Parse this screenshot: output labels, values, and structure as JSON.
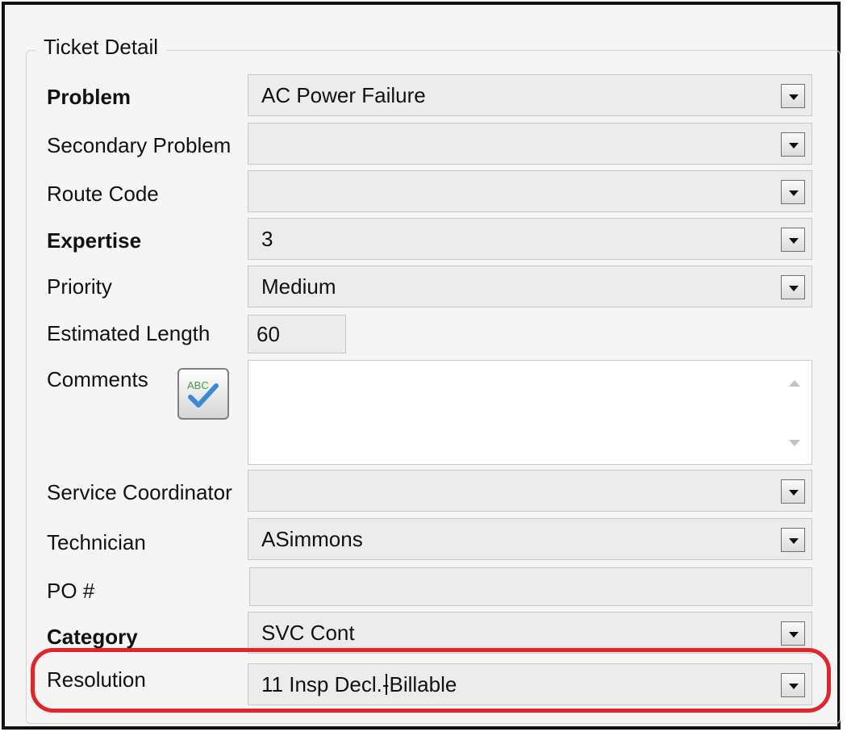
{
  "group_title": "Ticket Detail",
  "fields": {
    "problem": {
      "label": "Problem",
      "value": "AC Power Failure"
    },
    "secondary_problem": {
      "label": "Secondary Problem",
      "value": ""
    },
    "route_code": {
      "label": "Route Code",
      "value": ""
    },
    "expertise": {
      "label": "Expertise",
      "value": "3"
    },
    "priority": {
      "label": "Priority",
      "value": "Medium"
    },
    "estimated_length": {
      "label": "Estimated Length",
      "value": "60"
    },
    "comments": {
      "label": "Comments",
      "value": ""
    },
    "service_coordinator": {
      "label": "Service Coordinator",
      "value": ""
    },
    "technician": {
      "label": "Technician",
      "value": "ASimmons"
    },
    "po_number": {
      "label": "PO #",
      "value": ""
    },
    "category": {
      "label": "Category",
      "value": "SVC Cont"
    },
    "resolution": {
      "label": "Resolution",
      "value_before_caret": "11 Insp Decl.-",
      "value_after_caret": "Billable"
    }
  },
  "spellcheck_icon_text": "ABC",
  "colors": {
    "highlight": "#e2252b",
    "spellcheck_check": "#3a8ad8"
  }
}
